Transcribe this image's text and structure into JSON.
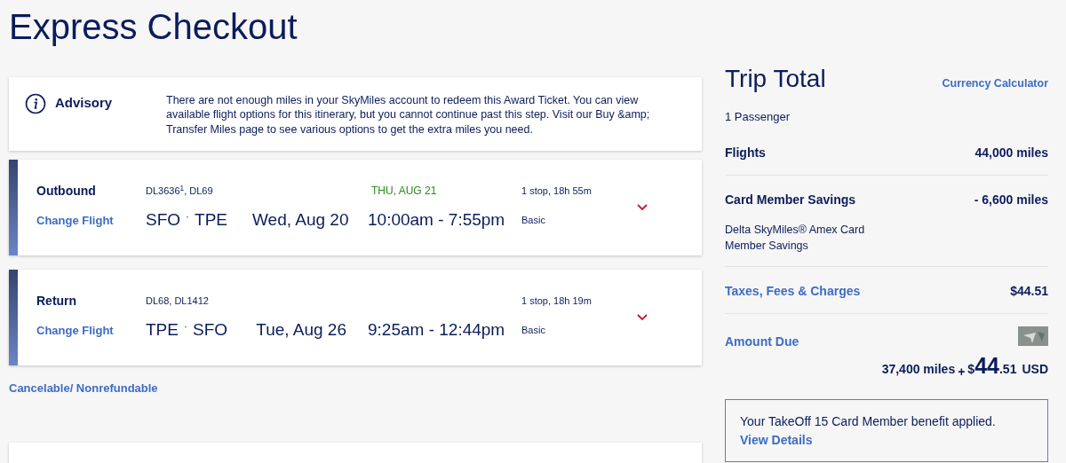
{
  "title": "Express Checkout",
  "advisory": {
    "label": "Advisory",
    "message": "There are not enough miles in your SkyMiles account to redeem this Award Ticket. You can view available flight options for this itinerary, but you cannot continue past this step. Visit our Buy &amp; Transfer Miles page to see various options to get the extra miles you need."
  },
  "flights": [
    {
      "label": "Outbound",
      "change_link": "Change Flight",
      "flight_numbers": "DL3636$^{1}$, DL69",
      "origin": "SFO",
      "separator": "·",
      "destination": "TPE",
      "date": "Wed, Aug 20",
      "arrival_date": "THU, AUG 21",
      "times": "10:00am - 7:55pm",
      "stops": "1 stop, 18h 55m",
      "fare": "Basic",
      "expanded": false
    },
    {
      "label": "Return",
      "change_link": "Change Flight",
      "flight_numbers": "DL68, DL1412",
      "origin": "TPE",
      "separator": "·",
      "destination": "SFO",
      "date": "Tue, Aug 26",
      "times": "9:25am - 12:44pm",
      "stops": "1 stop, 18h 19m",
      "fare": "Basic",
      "expanded": false
    }
  ],
  "cancel_policy": "Cancelable/ Nonrefundable",
  "trip_total": {
    "title": "Trip Total",
    "currency_link": "Currency Calculator",
    "passengers": "1 Passenger",
    "lines": [
      {
        "kind": "plain",
        "label": "Flights",
        "value": "44,000 miles"
      },
      {
        "kind": "plain",
        "label": "Card Member Savings",
        "value": "- 6,600 miles",
        "note": "Delta SkyMiles® Amex Card Member Savings"
      },
      {
        "kind": "link",
        "label": "Taxes, Fees & Charges",
        "value": "$44.51"
      }
    ],
    "amount_due": {
      "label": "Amount Due",
      "miles": "37,400 miles",
      "plus": "+",
      "currency_symbol": "$",
      "whole": "44",
      "cents": ".51",
      "currency": "USD"
    },
    "benefit": {
      "message": "Your TakeOff 15 Card Member benefit applied.",
      "link": "View Details"
    }
  }
}
